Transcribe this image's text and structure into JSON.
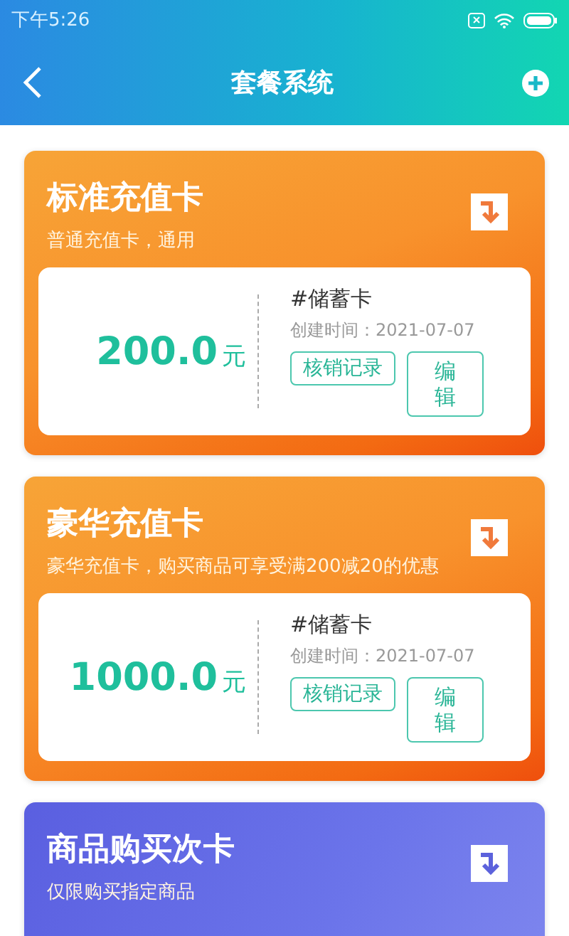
{
  "status_bar": {
    "time": "下午5:26"
  },
  "header": {
    "title": "套餐系统"
  },
  "cards": [
    {
      "kind": "orange",
      "title": "标准充值卡",
      "subtitle": "普通充值卡，通用",
      "detail": {
        "amount": "200.0",
        "unit": "元",
        "type": "#储蓄卡",
        "created": "创建时间：2021-07-07",
        "buttons": [
          "核销记录",
          "编辑"
        ]
      }
    },
    {
      "kind": "orange",
      "title": "豪华充值卡",
      "subtitle": "豪华充值卡，购买商品可享受满200减20的优惠",
      "detail": {
        "amount": "1000.0",
        "unit": "元",
        "type": "#储蓄卡",
        "created": "创建时间：2021-07-07",
        "buttons": [
          "核销记录",
          "编辑"
        ]
      }
    },
    {
      "kind": "purple",
      "title": "商品购买次卡",
      "subtitle": "仅限购买指定商品"
    }
  ]
}
